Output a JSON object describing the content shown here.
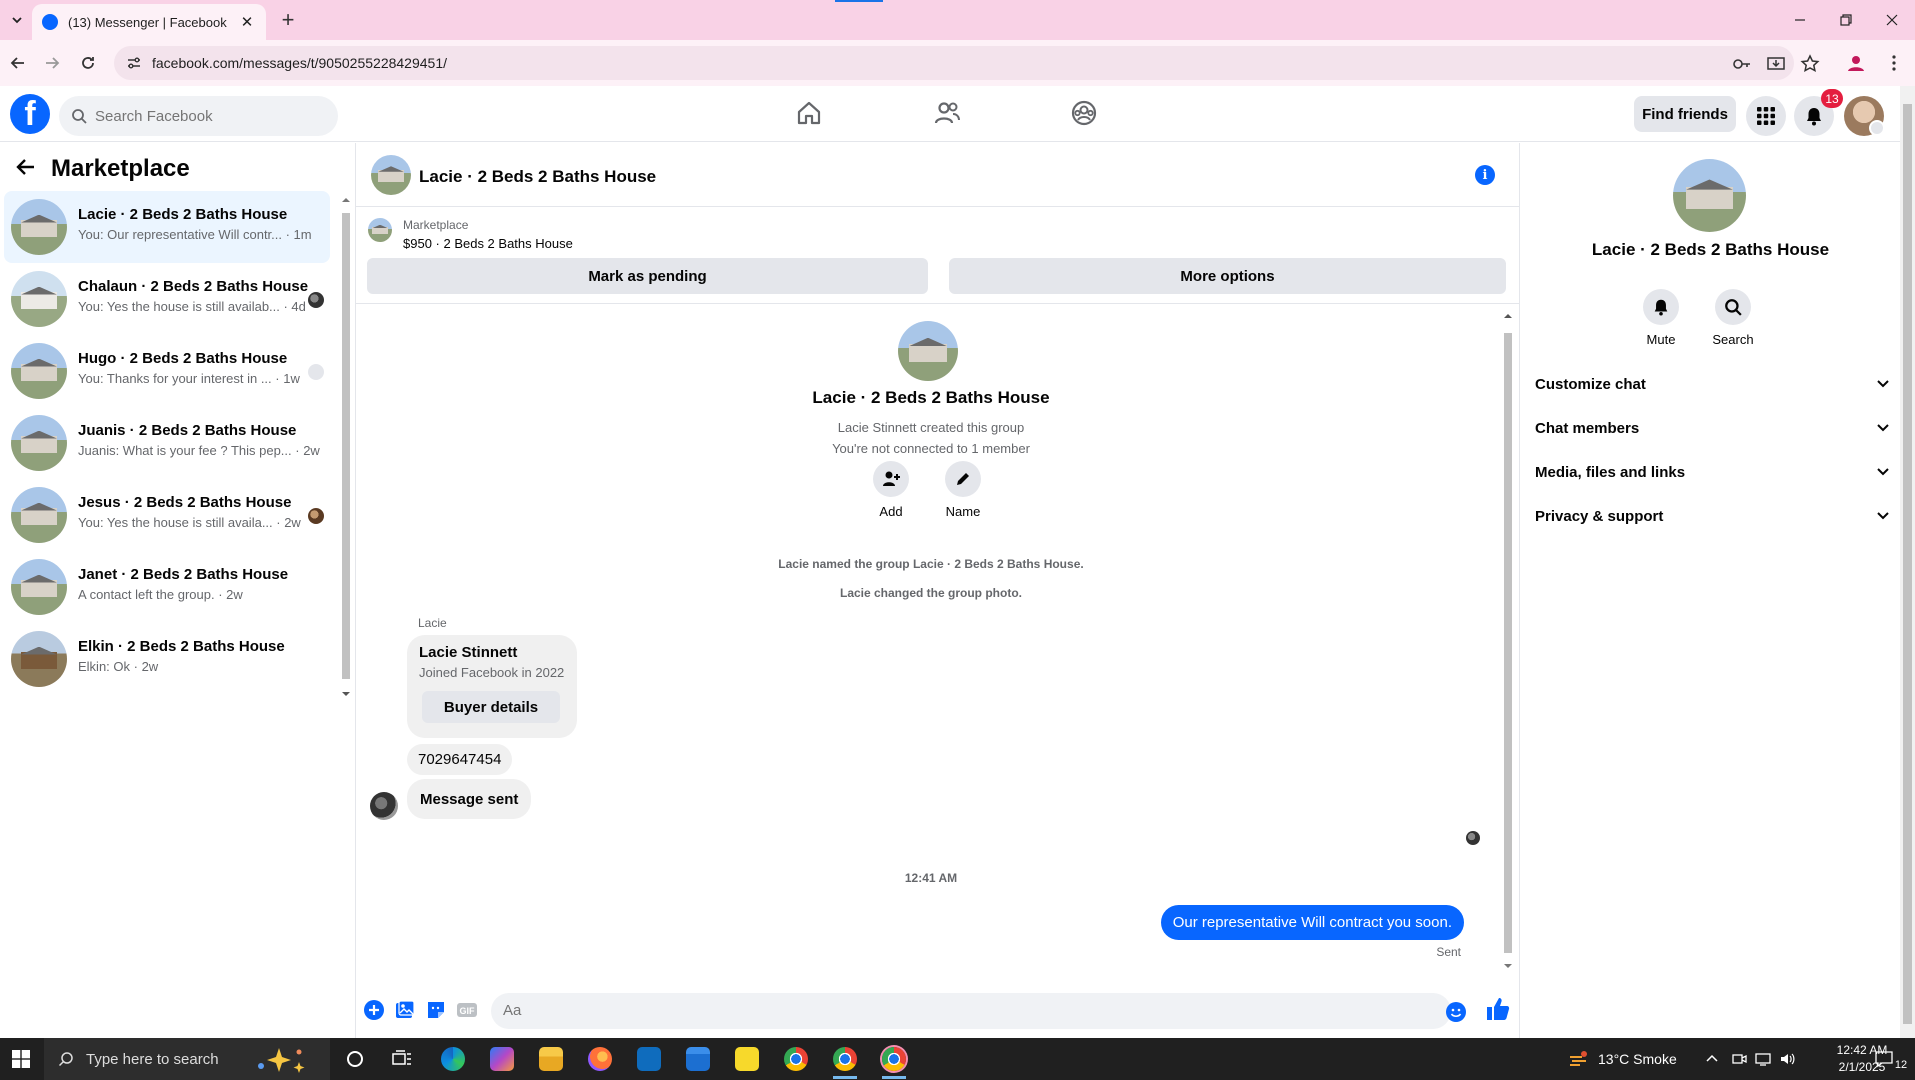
{
  "browser": {
    "tab_title": "(13) Messenger | Facebook",
    "url": "facebook.com/messages/t/9050255228429451/"
  },
  "fb": {
    "search_placeholder": "Search Facebook",
    "find_friends": "Find friends",
    "notification_count": "13",
    "brand_color": "#0866ff"
  },
  "marketplace_list": {
    "title": "Marketplace",
    "chats": [
      {
        "name": "Lacie · 2 Beds 2 Baths House",
        "preview": "You: Our representative Will contr... · 1m",
        "active": true
      },
      {
        "name": "Chalaun · 2 Beds 2 Baths House",
        "preview": "You: Yes the house is still availab... · 4d",
        "active": false
      },
      {
        "name": "Hugo · 2 Beds 2 Baths House",
        "preview": "You: Thanks for your interest in ... · 1w",
        "active": false
      },
      {
        "name": "Juanis · 2 Beds 2 Baths House",
        "preview": "Juanis: What is your fee ? This pep... · 2w",
        "active": false
      },
      {
        "name": "Jesus · 2 Beds 2 Baths House",
        "preview": "You: Yes the house is still availa... · 2w",
        "active": false
      },
      {
        "name": "Janet · 2 Beds 2 Baths House",
        "preview": "A contact left the group. · 2w",
        "active": false
      },
      {
        "name": "Elkin · 2 Beds 2 Baths House",
        "preview": "Elkin: Ok · 2w",
        "active": false
      }
    ]
  },
  "conversation": {
    "title": "Lacie · 2 Beds 2 Baths House",
    "marketplace_label": "Marketplace",
    "listing": "$950 · 2 Beds 2 Baths House",
    "mark_pending": "Mark as pending",
    "more_options": "More options",
    "intro_title": "Lacie · 2 Beds 2 Baths House",
    "created_by": "Lacie Stinnett created this group",
    "not_connected": "You're not connected to 1 member",
    "add_label": "Add",
    "name_label": "Name",
    "sys_named": "Lacie named the group Lacie · 2 Beds 2 Baths House.",
    "sys_photo": "Lacie changed the group photo.",
    "sender": "Lacie",
    "card_name": "Lacie Stinnett",
    "card_joined": "Joined Facebook in 2022",
    "buyer_details": "Buyer details",
    "phone": "7029647454",
    "message_sent": "Message sent",
    "timestamp": "12:41 AM",
    "outgoing": "Our representative Will contract you soon.",
    "sent_status": "Sent",
    "composer_placeholder": "Aa"
  },
  "info_pane": {
    "title": "Lacie · 2 Beds 2 Baths House",
    "mute": "Mute",
    "search": "Search",
    "sections": [
      "Customize chat",
      "Chat members",
      "Media, files and links",
      "Privacy & support"
    ]
  },
  "taskbar": {
    "search_placeholder": "Type here to search",
    "weather": "13°C  Smoke",
    "time": "12:42 AM",
    "date": "2/1/2025",
    "notifications": "12"
  }
}
